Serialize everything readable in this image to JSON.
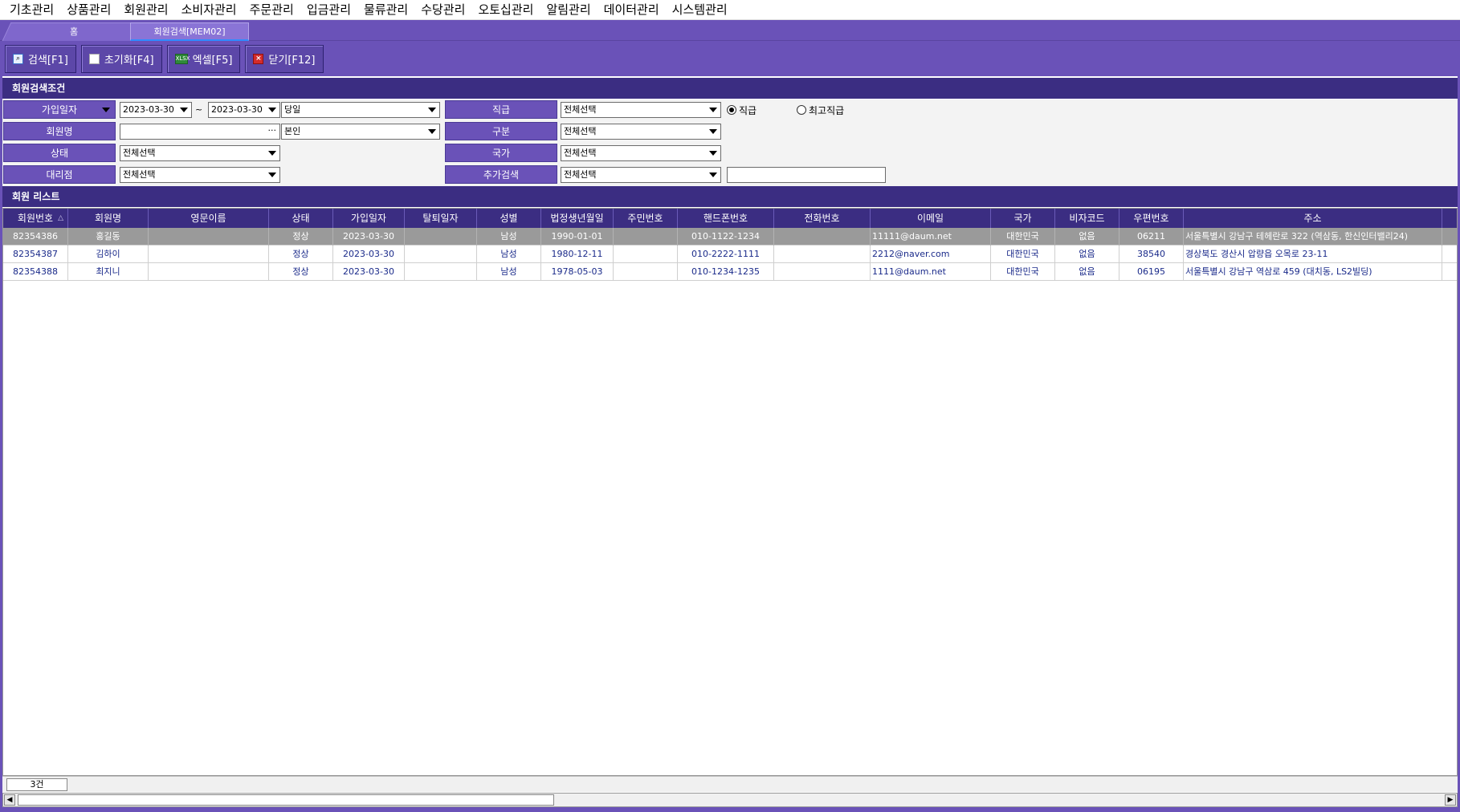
{
  "menu": [
    "기초관리",
    "상품관리",
    "회원관리",
    "소비자관리",
    "주문관리",
    "입금관리",
    "물류관리",
    "수당관리",
    "오토십관리",
    "알림관리",
    "데이터관리",
    "시스템관리"
  ],
  "tabs": {
    "home": "홈",
    "active": "회원검색[MEM02]"
  },
  "toolbar": {
    "search": "검색[F1]",
    "reset": "초기화[F4]",
    "excel": "엑셀[F5]",
    "excel_icon": "XLSX",
    "close": "닫기[F12]"
  },
  "conditions": {
    "title": "회원검색조건",
    "join_date_label": "가입일자",
    "date_from": "2023-03-30",
    "date_to": "2023-03-30",
    "tilde": "~",
    "period": "당일",
    "member_name_label": "회원명",
    "member_name_value": "",
    "member_scope": "본인",
    "status_label": "상태",
    "status_value": "전체선택",
    "agency_label": "대리점",
    "agency_value": "전체선택",
    "rank_label": "직급",
    "rank_value": "전체선택",
    "radio_rank": "직급",
    "radio_top_rank": "최고직급",
    "type_label": "구분",
    "type_value": "전체선택",
    "country_label": "국가",
    "country_value": "전체선택",
    "extra_label": "추가검색",
    "extra_value": "전체선택",
    "extra_text": ""
  },
  "list": {
    "title": "회원 리스트",
    "columns": [
      "회원번호",
      "회원명",
      "영문이름",
      "상태",
      "가입일자",
      "탈퇴일자",
      "성별",
      "법정생년월일",
      "주민번호",
      "핸드폰번호",
      "전화번호",
      "이메일",
      "국가",
      "비자코드",
      "우편번호",
      "주소"
    ],
    "sort_indicator": "△",
    "rows": [
      [
        "82354386",
        "홍길동",
        "",
        "정상",
        "2023-03-30",
        "",
        "남성",
        "1990-01-01",
        "",
        "010-1122-1234",
        "",
        "11111@daum.net",
        "대한민국",
        "없음",
        "06211",
        "서울특별시 강남구 테헤란로 322 (역삼동, 한신인터밸리24)"
      ],
      [
        "82354387",
        "김하이",
        "",
        "정상",
        "2023-03-30",
        "",
        "남성",
        "1980-12-11",
        "",
        "010-2222-1111",
        "",
        "2212@naver.com",
        "대한민국",
        "없음",
        "38540",
        "경상북도 경산시 압량읍 오목로 23-11"
      ],
      [
        "82354388",
        "최지니",
        "",
        "정상",
        "2023-03-30",
        "",
        "남성",
        "1978-05-03",
        "",
        "010-1234-1235",
        "",
        "1111@daum.net",
        "대한민국",
        "없음",
        "06195",
        "서울특별시 강남구 역삼로 459 (대치동, LS2빌딩)"
      ]
    ],
    "count": "3건"
  },
  "colors": {
    "primary": "#6a52b8",
    "header": "#3b2d82",
    "selected_row": "#9a9a9a"
  }
}
